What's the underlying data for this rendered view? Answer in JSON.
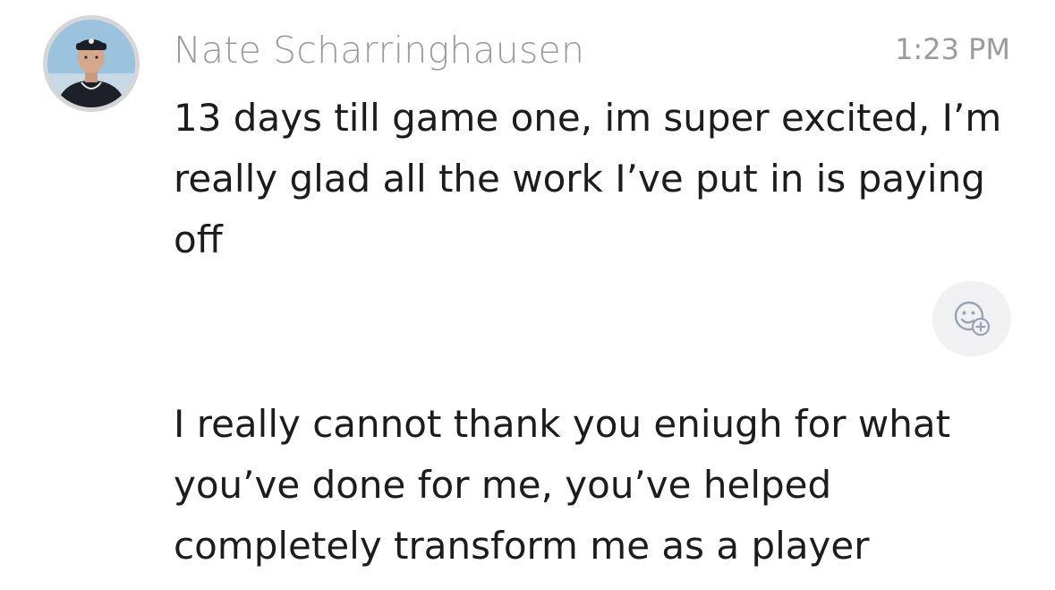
{
  "message": {
    "sender_name": "Nate Scharringhausen",
    "timestamp": "1:23 PM",
    "paragraphs": [
      "13 days till game one, im super excited, I’m really glad all the work I’ve put in is paying off",
      "I really cannot thank you eniugh for what you’ve done for me, you’ve helped completely transform me as a player"
    ],
    "avatar_icon": "profile-photo",
    "reaction_icon": "emoji-add-icon"
  },
  "colors": {
    "name_gray": "#9b9b9f",
    "text_dark": "#1c1c1e",
    "reaction_bg": "#f1f1f3",
    "avatar_ring": "#d6d6d8"
  }
}
